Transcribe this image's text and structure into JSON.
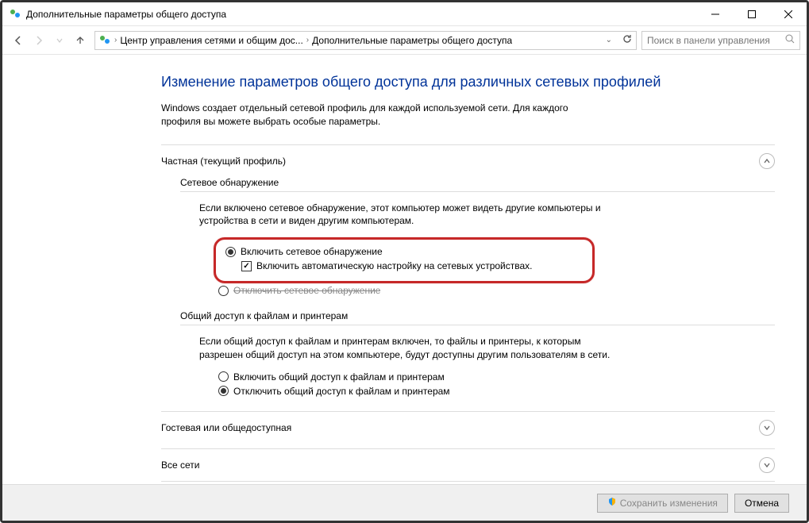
{
  "window": {
    "title": "Дополнительные параметры общего доступа"
  },
  "breadcrumb": {
    "item1": "Центр управления сетями и общим дос...",
    "item2": "Дополнительные параметры общего доступа"
  },
  "search": {
    "placeholder": "Поиск в панели управления"
  },
  "page": {
    "title": "Изменение параметров общего доступа для различных сетевых профилей",
    "desc": "Windows создает отдельный сетевой профиль для каждой используемой сети. Для каждого профиля вы можете выбрать особые параметры."
  },
  "profiles": {
    "private": {
      "header": "Частная (текущий профиль)",
      "discovery": {
        "title": "Сетевое обнаружение",
        "desc": "Если включено сетевое обнаружение, этот компьютер может видеть другие компьютеры и устройства в сети и виден другим компьютерам.",
        "opt_on": "Включить сетевое обнаружение",
        "opt_auto": "Включить автоматическую настройку на сетевых устройствах.",
        "opt_off": "Отключить сетевое обнаружение"
      },
      "sharing": {
        "title": "Общий доступ к файлам и принтерам",
        "desc": "Если общий доступ к файлам и принтерам включен, то файлы и принтеры, к которым разрешен общий доступ на этом компьютере, будут доступны другим пользователям в сети.",
        "opt_on": "Включить общий доступ к файлам и принтерам",
        "opt_off": "Отключить общий доступ к файлам и принтерам"
      }
    },
    "guest": {
      "header": "Гостевая или общедоступная"
    },
    "all": {
      "header": "Все сети"
    }
  },
  "footer": {
    "save": "Сохранить изменения",
    "cancel": "Отмена"
  }
}
